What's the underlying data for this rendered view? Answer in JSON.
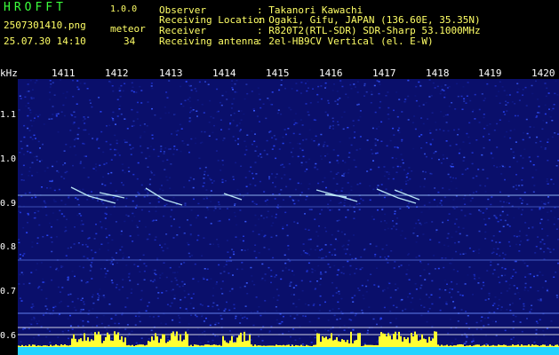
{
  "header": {
    "app_title": "HROFFT",
    "version": "1.0.0",
    "file_name": "2507301410.png",
    "datetime": "25.07.30 14:10",
    "category_label": "meteor",
    "count": "34"
  },
  "station": {
    "labels": [
      "Observer",
      "Receiving Location",
      "Receiver",
      "Receiving antenna"
    ],
    "values": [
      ": Takanori Kawachi",
      ": Ogaki, Gifu, JAPAN (136.60E, 35.35N)",
      ": R820T2(RTL-SDR) SDR-Sharp 53.1000MHz",
      ": 2el-HB9CV Vertical (el. E-W)"
    ]
  },
  "axes": {
    "y_unit": "kHz",
    "x_ticks": [
      "1411",
      "1412",
      "1413",
      "1414",
      "1415",
      "1416",
      "1417",
      "1418",
      "1419",
      "1420"
    ],
    "y_ticks": [
      "1.1",
      "1.0",
      "0.9",
      "0.8",
      "0.7",
      "0.6"
    ]
  },
  "colors": {
    "background": "#000000",
    "noise_blue": "#1a2bbf",
    "signal": "#bfefff",
    "level_yellow": "#ffff33",
    "level_cyan": "#22d3ff"
  }
}
